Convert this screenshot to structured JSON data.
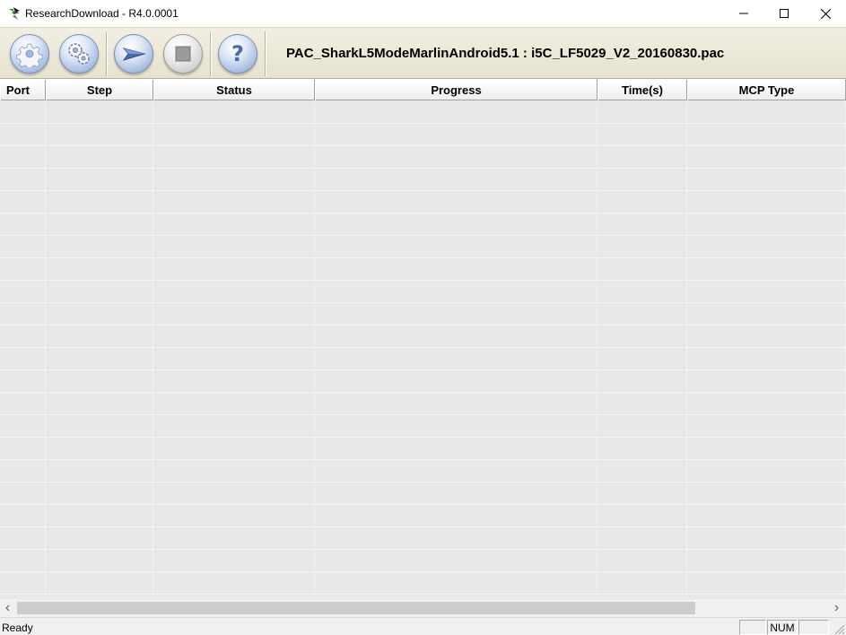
{
  "window": {
    "title": "ResearchDownload - R4.0.0001",
    "icons": {
      "app": "research-download-icon",
      "minimize": "minimize-icon",
      "maximize": "maximize-icon",
      "close": "close-icon"
    }
  },
  "toolbar": {
    "buttons": [
      {
        "icon": "gear-icon"
      },
      {
        "icon": "gears-icon"
      },
      {
        "icon": "play-arrow-icon"
      },
      {
        "icon": "stop-icon"
      },
      {
        "icon": "help-icon",
        "glyph": "?"
      }
    ],
    "pac_file": "PAC_SharkL5ModeMarlinAndroid5.1 : i5C_LF5029_V2_20160830.pac"
  },
  "table": {
    "columns": [
      "Port",
      "Step",
      "Status",
      "Progress",
      "Time(s)",
      "MCP Type"
    ],
    "rows": []
  },
  "scrollbar": {
    "left_arrow": "‹",
    "right_arrow": "›"
  },
  "statusbar": {
    "text": "Ready",
    "panes": [
      "",
      "NUM",
      ""
    ]
  },
  "colors": {
    "toolbar_bg": "#ece9d8",
    "grid_bg": "#e8e8e8",
    "button_blue": "#9fb7e0"
  }
}
